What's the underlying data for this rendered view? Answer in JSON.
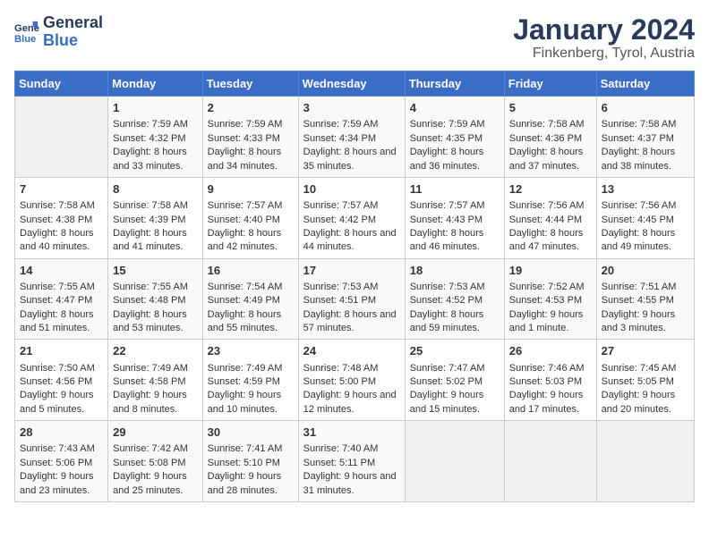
{
  "header": {
    "logo_line1": "General",
    "logo_line2": "Blue",
    "title": "January 2024",
    "subtitle": "Finkenberg, Tyrol, Austria"
  },
  "days_of_week": [
    "Sunday",
    "Monday",
    "Tuesday",
    "Wednesday",
    "Thursday",
    "Friday",
    "Saturday"
  ],
  "weeks": [
    [
      {
        "day": "",
        "data": ""
      },
      {
        "day": "1",
        "sunrise": "Sunrise: 7:59 AM",
        "sunset": "Sunset: 4:32 PM",
        "daylight": "Daylight: 8 hours and 33 minutes."
      },
      {
        "day": "2",
        "sunrise": "Sunrise: 7:59 AM",
        "sunset": "Sunset: 4:33 PM",
        "daylight": "Daylight: 8 hours and 34 minutes."
      },
      {
        "day": "3",
        "sunrise": "Sunrise: 7:59 AM",
        "sunset": "Sunset: 4:34 PM",
        "daylight": "Daylight: 8 hours and 35 minutes."
      },
      {
        "day": "4",
        "sunrise": "Sunrise: 7:59 AM",
        "sunset": "Sunset: 4:35 PM",
        "daylight": "Daylight: 8 hours and 36 minutes."
      },
      {
        "day": "5",
        "sunrise": "Sunrise: 7:58 AM",
        "sunset": "Sunset: 4:36 PM",
        "daylight": "Daylight: 8 hours and 37 minutes."
      },
      {
        "day": "6",
        "sunrise": "Sunrise: 7:58 AM",
        "sunset": "Sunset: 4:37 PM",
        "daylight": "Daylight: 8 hours and 38 minutes."
      }
    ],
    [
      {
        "day": "7",
        "sunrise": "Sunrise: 7:58 AM",
        "sunset": "Sunset: 4:38 PM",
        "daylight": "Daylight: 8 hours and 40 minutes."
      },
      {
        "day": "8",
        "sunrise": "Sunrise: 7:58 AM",
        "sunset": "Sunset: 4:39 PM",
        "daylight": "Daylight: 8 hours and 41 minutes."
      },
      {
        "day": "9",
        "sunrise": "Sunrise: 7:57 AM",
        "sunset": "Sunset: 4:40 PM",
        "daylight": "Daylight: 8 hours and 42 minutes."
      },
      {
        "day": "10",
        "sunrise": "Sunrise: 7:57 AM",
        "sunset": "Sunset: 4:42 PM",
        "daylight": "Daylight: 8 hours and 44 minutes."
      },
      {
        "day": "11",
        "sunrise": "Sunrise: 7:57 AM",
        "sunset": "Sunset: 4:43 PM",
        "daylight": "Daylight: 8 hours and 46 minutes."
      },
      {
        "day": "12",
        "sunrise": "Sunrise: 7:56 AM",
        "sunset": "Sunset: 4:44 PM",
        "daylight": "Daylight: 8 hours and 47 minutes."
      },
      {
        "day": "13",
        "sunrise": "Sunrise: 7:56 AM",
        "sunset": "Sunset: 4:45 PM",
        "daylight": "Daylight: 8 hours and 49 minutes."
      }
    ],
    [
      {
        "day": "14",
        "sunrise": "Sunrise: 7:55 AM",
        "sunset": "Sunset: 4:47 PM",
        "daylight": "Daylight: 8 hours and 51 minutes."
      },
      {
        "day": "15",
        "sunrise": "Sunrise: 7:55 AM",
        "sunset": "Sunset: 4:48 PM",
        "daylight": "Daylight: 8 hours and 53 minutes."
      },
      {
        "day": "16",
        "sunrise": "Sunrise: 7:54 AM",
        "sunset": "Sunset: 4:49 PM",
        "daylight": "Daylight: 8 hours and 55 minutes."
      },
      {
        "day": "17",
        "sunrise": "Sunrise: 7:53 AM",
        "sunset": "Sunset: 4:51 PM",
        "daylight": "Daylight: 8 hours and 57 minutes."
      },
      {
        "day": "18",
        "sunrise": "Sunrise: 7:53 AM",
        "sunset": "Sunset: 4:52 PM",
        "daylight": "Daylight: 8 hours and 59 minutes."
      },
      {
        "day": "19",
        "sunrise": "Sunrise: 7:52 AM",
        "sunset": "Sunset: 4:53 PM",
        "daylight": "Daylight: 9 hours and 1 minute."
      },
      {
        "day": "20",
        "sunrise": "Sunrise: 7:51 AM",
        "sunset": "Sunset: 4:55 PM",
        "daylight": "Daylight: 9 hours and 3 minutes."
      }
    ],
    [
      {
        "day": "21",
        "sunrise": "Sunrise: 7:50 AM",
        "sunset": "Sunset: 4:56 PM",
        "daylight": "Daylight: 9 hours and 5 minutes."
      },
      {
        "day": "22",
        "sunrise": "Sunrise: 7:49 AM",
        "sunset": "Sunset: 4:58 PM",
        "daylight": "Daylight: 9 hours and 8 minutes."
      },
      {
        "day": "23",
        "sunrise": "Sunrise: 7:49 AM",
        "sunset": "Sunset: 4:59 PM",
        "daylight": "Daylight: 9 hours and 10 minutes."
      },
      {
        "day": "24",
        "sunrise": "Sunrise: 7:48 AM",
        "sunset": "Sunset: 5:00 PM",
        "daylight": "Daylight: 9 hours and 12 minutes."
      },
      {
        "day": "25",
        "sunrise": "Sunrise: 7:47 AM",
        "sunset": "Sunset: 5:02 PM",
        "daylight": "Daylight: 9 hours and 15 minutes."
      },
      {
        "day": "26",
        "sunrise": "Sunrise: 7:46 AM",
        "sunset": "Sunset: 5:03 PM",
        "daylight": "Daylight: 9 hours and 17 minutes."
      },
      {
        "day": "27",
        "sunrise": "Sunrise: 7:45 AM",
        "sunset": "Sunset: 5:05 PM",
        "daylight": "Daylight: 9 hours and 20 minutes."
      }
    ],
    [
      {
        "day": "28",
        "sunrise": "Sunrise: 7:43 AM",
        "sunset": "Sunset: 5:06 PM",
        "daylight": "Daylight: 9 hours and 23 minutes."
      },
      {
        "day": "29",
        "sunrise": "Sunrise: 7:42 AM",
        "sunset": "Sunset: 5:08 PM",
        "daylight": "Daylight: 9 hours and 25 minutes."
      },
      {
        "day": "30",
        "sunrise": "Sunrise: 7:41 AM",
        "sunset": "Sunset: 5:10 PM",
        "daylight": "Daylight: 9 hours and 28 minutes."
      },
      {
        "day": "31",
        "sunrise": "Sunrise: 7:40 AM",
        "sunset": "Sunset: 5:11 PM",
        "daylight": "Daylight: 9 hours and 31 minutes."
      },
      {
        "day": "",
        "data": ""
      },
      {
        "day": "",
        "data": ""
      },
      {
        "day": "",
        "data": ""
      }
    ]
  ]
}
